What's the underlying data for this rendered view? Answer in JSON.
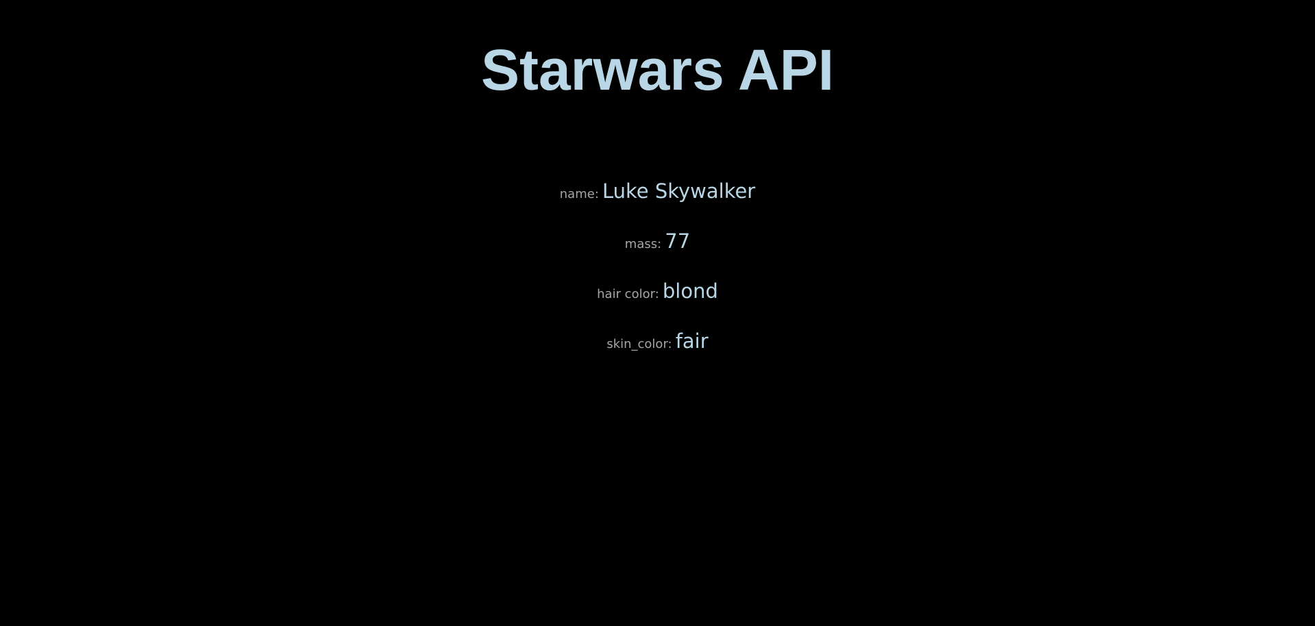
{
  "page": {
    "title": "Starwars API"
  },
  "character": {
    "fields": [
      {
        "label": "name:",
        "value": "Luke Skywalker"
      },
      {
        "label": "mass:",
        "value": "77"
      },
      {
        "label": "hair color:",
        "value": "blond"
      },
      {
        "label": "skin_color:",
        "value": "fair"
      }
    ]
  },
  "colors": {
    "background": "#000000",
    "accent": "#b9d6e6",
    "label": "#a6a6a6"
  }
}
